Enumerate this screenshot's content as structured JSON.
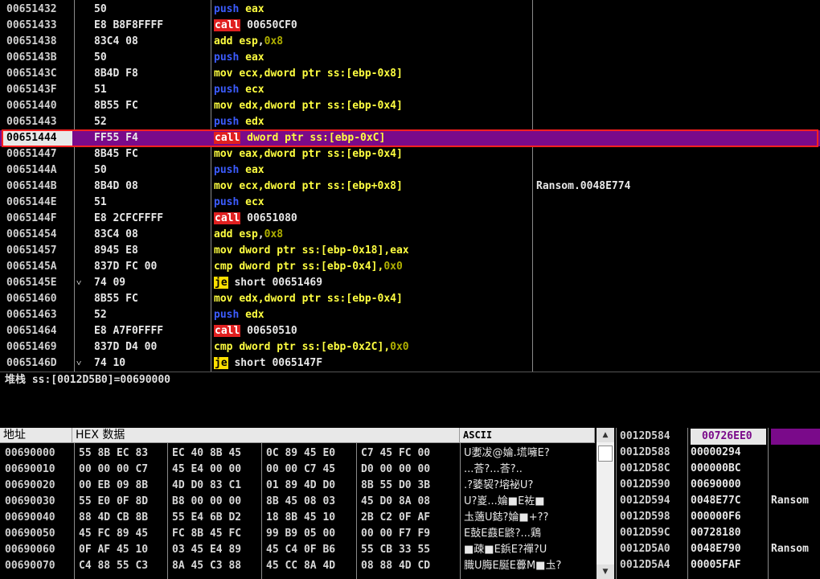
{
  "disasm": {
    "rows": [
      {
        "addr": "00651432",
        "bytes": "50",
        "mnem": "push",
        "ops": [
          {
            "t": "eax",
            "c": "rg"
          }
        ],
        "comment": ""
      },
      {
        "addr": "00651433",
        "bytes": "E8 B8F8FFFF",
        "mnem": "call",
        "ops": [
          {
            "t": "00650CF0",
            "c": "txt"
          }
        ],
        "comment": ""
      },
      {
        "addr": "00651438",
        "bytes": "83C4 08",
        "mnem": "add",
        "ops": [
          {
            "t": "esp",
            "c": "rg"
          },
          {
            "t": ",",
            "c": "txt"
          },
          {
            "t": "0x8",
            "c": "num"
          }
        ],
        "comment": ""
      },
      {
        "addr": "0065143B",
        "bytes": "50",
        "mnem": "push",
        "ops": [
          {
            "t": "eax",
            "c": "rg"
          }
        ],
        "comment": ""
      },
      {
        "addr": "0065143C",
        "bytes": "8B4D F8",
        "mnem": "mov",
        "ops": [
          {
            "t": "ecx,dword ptr ss:[ebp-0x8]",
            "c": "rg"
          }
        ],
        "comment": ""
      },
      {
        "addr": "0065143F",
        "bytes": "51",
        "mnem": "push",
        "ops": [
          {
            "t": "ecx",
            "c": "rg"
          }
        ],
        "comment": ""
      },
      {
        "addr": "00651440",
        "bytes": "8B55 FC",
        "mnem": "mov",
        "ops": [
          {
            "t": "edx,dword ptr ss:[ebp-0x4]",
            "c": "rg"
          }
        ],
        "comment": ""
      },
      {
        "addr": "00651443",
        "bytes": "52",
        "mnem": "push",
        "ops": [
          {
            "t": "edx",
            "c": "rg"
          }
        ],
        "comment": ""
      },
      {
        "addr": "00651444",
        "bytes": "FF55 F4",
        "mnem": "call",
        "ops": [
          {
            "t": "dword ptr ss:[ebp-0xC]",
            "c": "rg"
          }
        ],
        "comment": "",
        "selected": true
      },
      {
        "addr": "00651447",
        "bytes": "8B45 FC",
        "mnem": "mov",
        "ops": [
          {
            "t": "eax,dword ptr ss:[ebp-0x4]",
            "c": "rg"
          }
        ],
        "comment": ""
      },
      {
        "addr": "0065144A",
        "bytes": "50",
        "mnem": "push",
        "ops": [
          {
            "t": "eax",
            "c": "rg"
          }
        ],
        "comment": ""
      },
      {
        "addr": "0065144B",
        "bytes": "8B4D 08",
        "mnem": "mov",
        "ops": [
          {
            "t": "ecx,dword ptr ss:[ebp+0x8]",
            "c": "rg"
          }
        ],
        "comment": "Ransom.0048E774"
      },
      {
        "addr": "0065144E",
        "bytes": "51",
        "mnem": "push",
        "ops": [
          {
            "t": "ecx",
            "c": "rg"
          }
        ],
        "comment": ""
      },
      {
        "addr": "0065144F",
        "bytes": "E8 2CFCFFFF",
        "mnem": "call",
        "ops": [
          {
            "t": "00651080",
            "c": "txt"
          }
        ],
        "comment": ""
      },
      {
        "addr": "00651454",
        "bytes": "83C4 08",
        "mnem": "add",
        "ops": [
          {
            "t": "esp",
            "c": "rg"
          },
          {
            "t": ",",
            "c": "txt"
          },
          {
            "t": "0x8",
            "c": "num"
          }
        ],
        "comment": ""
      },
      {
        "addr": "00651457",
        "bytes": "8945 E8",
        "mnem": "mov",
        "ops": [
          {
            "t": "dword ptr ss:[ebp-0x18],eax",
            "c": "rg"
          }
        ],
        "comment": ""
      },
      {
        "addr": "0065145A",
        "bytes": "837D FC 00",
        "mnem": "cmp",
        "ops": [
          {
            "t": "dword ptr ss:[ebp-0x4],",
            "c": "rg"
          },
          {
            "t": "0x0",
            "c": "num"
          }
        ],
        "comment": ""
      },
      {
        "addr": "0065145E",
        "bytes": "74 09",
        "mnem": "je",
        "ops": [
          {
            "t": "short 00651469",
            "c": "txt"
          }
        ],
        "comment": "",
        "jump": true
      },
      {
        "addr": "00651460",
        "bytes": "8B55 FC",
        "mnem": "mov",
        "ops": [
          {
            "t": "edx,dword ptr ss:[ebp-0x4]",
            "c": "rg"
          }
        ],
        "comment": ""
      },
      {
        "addr": "00651463",
        "bytes": "52",
        "mnem": "push",
        "ops": [
          {
            "t": "edx",
            "c": "rg"
          }
        ],
        "comment": ""
      },
      {
        "addr": "00651464",
        "bytes": "E8 A7F0FFFF",
        "mnem": "call",
        "ops": [
          {
            "t": "00650510",
            "c": "txt"
          }
        ],
        "comment": ""
      },
      {
        "addr": "00651469",
        "bytes": "837D D4 00",
        "mnem": "cmp",
        "ops": [
          {
            "t": "dword ptr ss:[ebp-0x2C],",
            "c": "rg"
          },
          {
            "t": "0x0",
            "c": "num"
          }
        ],
        "comment": ""
      },
      {
        "addr": "0065146D",
        "bytes": "74 10",
        "mnem": "je",
        "ops": [
          {
            "t": "short 0065147F",
            "c": "txt"
          }
        ],
        "comment": "",
        "jump": true
      }
    ]
  },
  "info": {
    "text": "堆栈 ss:[0012D5B0]=00690000"
  },
  "dump": {
    "header_addr": "地址",
    "header_hex": "HEX 数据",
    "header_ascii": "ASCII",
    "rows": [
      {
        "addr": "00690000",
        "hex": [
          "55 8B EC 83",
          "EC 40 8B 45",
          "0C 89 45 E0",
          "C7 45 FC 00"
        ],
        "ascii": "U嬱冹@婨.塃噰E?"
      },
      {
        "addr": "00690010",
        "hex": [
          "00 00 00 C7",
          "45 E4 00 00",
          "00 00 C7 45",
          "D0 00 00 00"
        ],
        "ascii": "...荅?...荅?.."
      },
      {
        "addr": "00690020",
        "hex": [
          "00 EB 09 8B",
          "4D D0 83 C1",
          "01 89 4D D0",
          "8B 55 D0 3B"
        ],
        "ascii": ".?婱袃?塎袐U?"
      },
      {
        "addr": "00690030",
        "hex": [
          "55 E0 0F 8D",
          "B8 00 00 00",
          "8B 45 08 03",
          "45 D0 8A 08"
        ],
        "ascii": "U?嵏...婨■E袏■"
      },
      {
        "addr": "00690040",
        "hex": [
          "88 4D CB 8B",
          "55 E4 6B D2",
          "18 8B 45 10",
          "2B C2 0F AF"
        ],
        "ascii": "圡藡U鋕?婨■+??"
      },
      {
        "addr": "00690050",
        "hex": [
          "45 FC 89 45",
          "FC 8B 45 FC",
          "99 B9 05 00",
          "00 00 F7 F9"
        ],
        "ascii": "E鼔E鼖E鼨?...鶏"
      },
      {
        "addr": "00690060",
        "hex": [
          "0F AF 45 10",
          "03 45 E4 89",
          "45 C4 0F B6",
          "55 CB 33 55"
        ],
        "ascii": "■疎■E鋲E?禪?U"
      },
      {
        "addr": "00690070",
        "hex": [
          "C4 88 55 C3",
          "8A 45 C3 88",
          "45 CC 8A 4D",
          "08 88 4D CD"
        ],
        "ascii": "膱U脢E脠E虋M■圡?"
      }
    ]
  },
  "stack": {
    "rows": [
      {
        "addr": "0012D584",
        "value": "00726EE0",
        "comment": "",
        "selected": true
      },
      {
        "addr": "0012D588",
        "value": "00000294",
        "comment": ""
      },
      {
        "addr": "0012D58C",
        "value": "000000BC",
        "comment": ""
      },
      {
        "addr": "0012D590",
        "value": "00690000",
        "comment": ""
      },
      {
        "addr": "0012D594",
        "value": "0048E77C",
        "comment": "Ransom"
      },
      {
        "addr": "0012D598",
        "value": "000000F6",
        "comment": ""
      },
      {
        "addr": "0012D59C",
        "value": "00728180",
        "comment": ""
      },
      {
        "addr": "0012D5A0",
        "value": "0048E790",
        "comment": "Ransom"
      },
      {
        "addr": "0012D5A4",
        "value": "00005FAF",
        "comment": ""
      }
    ]
  },
  "colors": {
    "call_bg": "#e02020",
    "je_bg": "#ffe000",
    "push": "#3c5cff",
    "reg": "#ffff40",
    "selected_row": "#7a0a8a",
    "border_highlight": "#ff2020"
  }
}
